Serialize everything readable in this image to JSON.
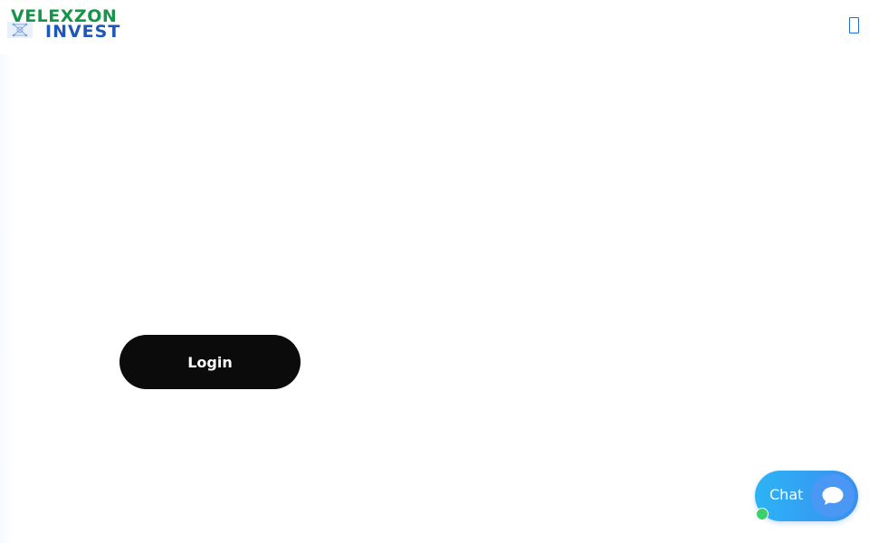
{
  "brand": {
    "line1": "VELEXZON",
    "line2": "INVEST",
    "logo_icon": "network-icon"
  },
  "header": {
    "menu_icon": "menu-icon"
  },
  "main": {
    "login_label": "Login"
  },
  "chat": {
    "label": "Chat",
    "icon": "chat-bubble-icon",
    "status": "online"
  },
  "colors": {
    "brand_green": "#169447",
    "brand_blue": "#1f57b8",
    "button_dark": "#0b0b0c",
    "chat_blue": "#2cb3f5",
    "online_green": "#3ccf6e"
  }
}
